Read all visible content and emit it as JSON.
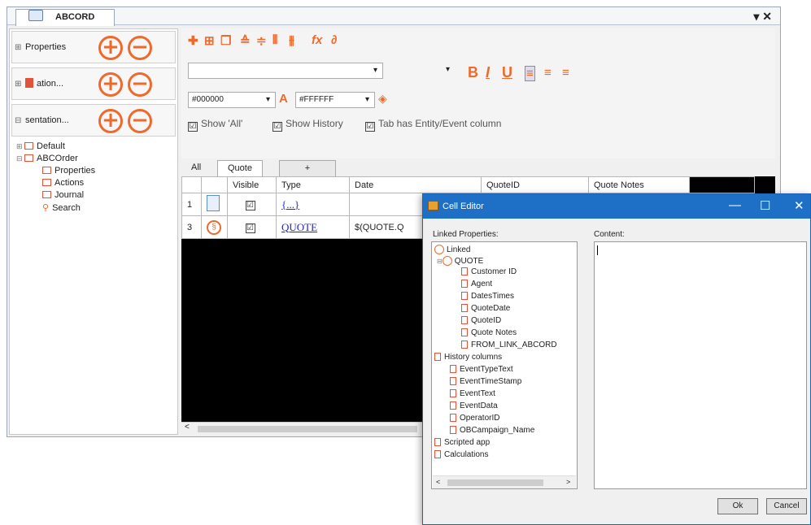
{
  "doc_tab": {
    "title": "ABCORD",
    "controls": "▾ ✕"
  },
  "left_panel": {
    "rows": [
      {
        "expander": "⊞",
        "label": "Properties"
      },
      {
        "expander": "⊞",
        "label": "ation..."
      },
      {
        "expander": "⊟",
        "label": "sentation..."
      }
    ],
    "add_symbol": "+",
    "remove_symbol": "−",
    "tree": {
      "default": "Default",
      "order": "ABCOrder",
      "children": [
        "Properties",
        "Actions",
        "Journal",
        "Search"
      ]
    }
  },
  "toolbar": {
    "font_name": "",
    "font_size": "",
    "fore_color": "#000000",
    "back_color": "#FFFFFF",
    "bold": "B",
    "italic": "I",
    "underline": "U",
    "show_all": "Show 'All'",
    "show_history": "Show History",
    "tab_entity": "Tab has Entity/Event column"
  },
  "grid_tabs": [
    "All",
    "Quote",
    "+"
  ],
  "grid": {
    "columns": [
      "",
      "",
      "Visible",
      "Type",
      "Date",
      "QuoteID",
      "Quote Notes",
      ""
    ],
    "rows": [
      {
        "num": "1",
        "type": "{...}",
        "date": ""
      },
      {
        "num": "3",
        "type": "QUOTE",
        "date": "$(QUOTE.Q"
      }
    ],
    "check_mark": "☑",
    "scroll_left": "<"
  },
  "dialog": {
    "title": "Cell Editor",
    "minimize": "—",
    "maximize": "☐",
    "close": "✕",
    "linked_label": "Linked Properties:",
    "content_label": "Content:",
    "tree": {
      "linked": "Linked",
      "quote": "QUOTE",
      "quote_fields": [
        "Customer ID",
        "Agent",
        "DatesTimes",
        "QuoteDate",
        "QuoteID",
        "Quote Notes",
        "FROM_LINK_ABCORD"
      ],
      "history": "History columns",
      "history_fields": [
        "EventTypeText",
        "EventTimeStamp",
        "EventText",
        "EventData",
        "OperatorID",
        "OBCampaign_Name"
      ],
      "scripted": "Scripted app",
      "calculations": "Calculations"
    },
    "scroll_left": "<",
    "scroll_right": ">",
    "ok": "Ok",
    "cancel": "Cancel"
  },
  "colors": {
    "accent": "#ee6a2c",
    "title_bar": "#1e6fc6",
    "link": "#1f1fd8"
  }
}
